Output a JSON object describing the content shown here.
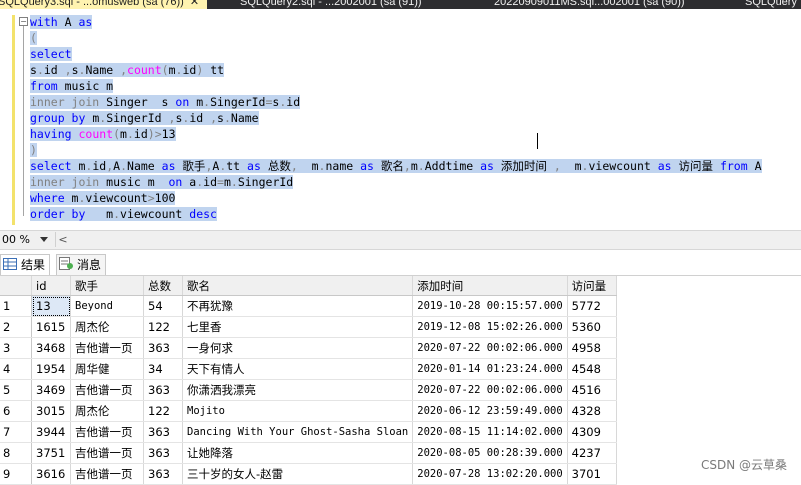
{
  "tabs": [
    {
      "label": "SQLQuery3.sql - ...omusweb (sa (76))",
      "active": true
    },
    {
      "label": "SQLQuery2.sql - ...2002001 (sa (91))",
      "active": false
    },
    {
      "label": "20220909011MS.sql...002001 (sa (90))",
      "active": false
    },
    {
      "label": "SQLQuery",
      "active": false
    }
  ],
  "editor": {
    "lines": [
      [
        {
          "t": "with",
          "c": "kw"
        },
        {
          "t": " A "
        },
        {
          "t": "as",
          "c": "kw"
        }
      ],
      [
        {
          "t": "(",
          "c": "gy"
        }
      ],
      [
        {
          "t": "select",
          "c": "kw"
        }
      ],
      [
        {
          "t": "s"
        },
        {
          "t": ".",
          "c": "gy"
        },
        {
          "t": "id "
        },
        {
          "t": ",",
          "c": "gy"
        },
        {
          "t": "s"
        },
        {
          "t": ".",
          "c": "gy"
        },
        {
          "t": "Name "
        },
        {
          "t": ",",
          "c": "gy"
        },
        {
          "t": "count",
          "c": "fn"
        },
        {
          "t": "(",
          "c": "gy"
        },
        {
          "t": "m"
        },
        {
          "t": ".",
          "c": "gy"
        },
        {
          "t": "id"
        },
        {
          "t": ")",
          "c": "gy"
        },
        {
          "t": " tt"
        }
      ],
      [
        {
          "t": "from",
          "c": "kw"
        },
        {
          "t": " music m"
        }
      ],
      [
        {
          "t": "inner join",
          "c": "gy"
        },
        {
          "t": " Singer  s "
        },
        {
          "t": "on",
          "c": "kw"
        },
        {
          "t": " m"
        },
        {
          "t": ".",
          "c": "gy"
        },
        {
          "t": "SingerId"
        },
        {
          "t": "=",
          "c": "gy"
        },
        {
          "t": "s"
        },
        {
          "t": ".",
          "c": "gy"
        },
        {
          "t": "id"
        }
      ],
      [
        {
          "t": "group by",
          "c": "kw"
        },
        {
          "t": " m"
        },
        {
          "t": ".",
          "c": "gy"
        },
        {
          "t": "SingerId "
        },
        {
          "t": ",",
          "c": "gy"
        },
        {
          "t": "s"
        },
        {
          "t": ".",
          "c": "gy"
        },
        {
          "t": "id "
        },
        {
          "t": ",",
          "c": "gy"
        },
        {
          "t": "s"
        },
        {
          "t": ".",
          "c": "gy"
        },
        {
          "t": "Name"
        }
      ],
      [
        {
          "t": "having",
          "c": "kw"
        },
        {
          "t": " "
        },
        {
          "t": "count",
          "c": "fn"
        },
        {
          "t": "(",
          "c": "gy"
        },
        {
          "t": "m"
        },
        {
          "t": ".",
          "c": "gy"
        },
        {
          "t": "id"
        },
        {
          "t": ")>",
          "c": "gy"
        },
        {
          "t": "13"
        }
      ],
      [
        {
          "t": ")",
          "c": "gy"
        }
      ],
      [
        {
          "t": "select",
          "c": "kw"
        },
        {
          "t": " m"
        },
        {
          "t": ".",
          "c": "gy"
        },
        {
          "t": "id"
        },
        {
          "t": ",",
          "c": "gy"
        },
        {
          "t": "A"
        },
        {
          "t": ".",
          "c": "gy"
        },
        {
          "t": "Name "
        },
        {
          "t": "as",
          "c": "kw"
        },
        {
          "t": " 歌手"
        },
        {
          "t": ",",
          "c": "gy"
        },
        {
          "t": "A"
        },
        {
          "t": ".",
          "c": "gy"
        },
        {
          "t": "tt "
        },
        {
          "t": "as",
          "c": "kw"
        },
        {
          "t": " 总数"
        },
        {
          "t": ",",
          "c": "gy"
        },
        {
          "t": "  m"
        },
        {
          "t": ".",
          "c": "gy"
        },
        {
          "t": "name "
        },
        {
          "t": "as",
          "c": "kw"
        },
        {
          "t": " 歌名"
        },
        {
          "t": ",",
          "c": "gy"
        },
        {
          "t": "m"
        },
        {
          "t": ".",
          "c": "gy"
        },
        {
          "t": "Addtime "
        },
        {
          "t": "as",
          "c": "kw"
        },
        {
          "t": " 添加时间 "
        },
        {
          "t": ",",
          "c": "gy"
        },
        {
          "t": "  m"
        },
        {
          "t": ".",
          "c": "gy"
        },
        {
          "t": "viewcount "
        },
        {
          "t": "as",
          "c": "kw"
        },
        {
          "t": " 访问量 "
        },
        {
          "t": "from",
          "c": "kw"
        },
        {
          "t": " A"
        }
      ],
      [
        {
          "t": "inner join",
          "c": "gy"
        },
        {
          "t": " music m  "
        },
        {
          "t": "on",
          "c": "kw"
        },
        {
          "t": " a"
        },
        {
          "t": ".",
          "c": "gy"
        },
        {
          "t": "id"
        },
        {
          "t": "=",
          "c": "gy"
        },
        {
          "t": "m"
        },
        {
          "t": ".",
          "c": "gy"
        },
        {
          "t": "SingerId"
        }
      ],
      [
        {
          "t": "where",
          "c": "kw"
        },
        {
          "t": " m"
        },
        {
          "t": ".",
          "c": "gy"
        },
        {
          "t": "viewcount"
        },
        {
          "t": ">",
          "c": "gy"
        },
        {
          "t": "100"
        }
      ],
      [
        {
          "t": "order by",
          "c": "kw"
        },
        {
          "t": "   m"
        },
        {
          "t": ".",
          "c": "gy"
        },
        {
          "t": "viewcount "
        },
        {
          "t": "desc",
          "c": "kw"
        }
      ]
    ]
  },
  "statusbar": {
    "zoom": "00 %",
    "scroll_left": "<"
  },
  "result_tabs": [
    {
      "label": "结果",
      "active": true,
      "icon": "grid-icon"
    },
    {
      "label": "消息",
      "active": false,
      "icon": "message-icon"
    }
  ],
  "grid": {
    "columns": [
      "",
      "id",
      "歌手",
      "总数",
      "歌名",
      "添加时间",
      "访问量"
    ],
    "rows": [
      [
        "1",
        "13",
        "Beyond",
        "54",
        "不再犹豫",
        "2019-10-28 00:15:57.000",
        "5772"
      ],
      [
        "2",
        "1615",
        "周杰伦",
        "122",
        "七里香",
        "2019-12-08 15:02:26.000",
        "5360"
      ],
      [
        "3",
        "3468",
        "吉他谱一页",
        "363",
        "一身何求",
        "2020-07-22 00:02:06.000",
        "4958"
      ],
      [
        "4",
        "1954",
        "周华健",
        "34",
        "天下有情人",
        "2020-01-14 01:23:24.000",
        "4548"
      ],
      [
        "5",
        "3469",
        "吉他谱一页",
        "363",
        "你潇洒我漂亮",
        "2020-07-22 00:02:06.000",
        "4516"
      ],
      [
        "6",
        "3015",
        "周杰伦",
        "122",
        "Mojito",
        "2020-06-12 23:59:49.000",
        "4328"
      ],
      [
        "7",
        "3944",
        "吉他谱一页",
        "363",
        "Dancing With Your Ghost-Sasha Sloan",
        "2020-08-15 11:14:02.000",
        "4309"
      ],
      [
        "8",
        "3751",
        "吉他谱一页",
        "363",
        "让她降落",
        "2020-08-05 00:28:39.000",
        "4237"
      ],
      [
        "9",
        "3616",
        "吉他谱一页",
        "363",
        "三十岁的女人-赵雷",
        "2020-07-28 13:02:20.000",
        "3701"
      ]
    ]
  },
  "watermark": "CSDN @云草桑"
}
